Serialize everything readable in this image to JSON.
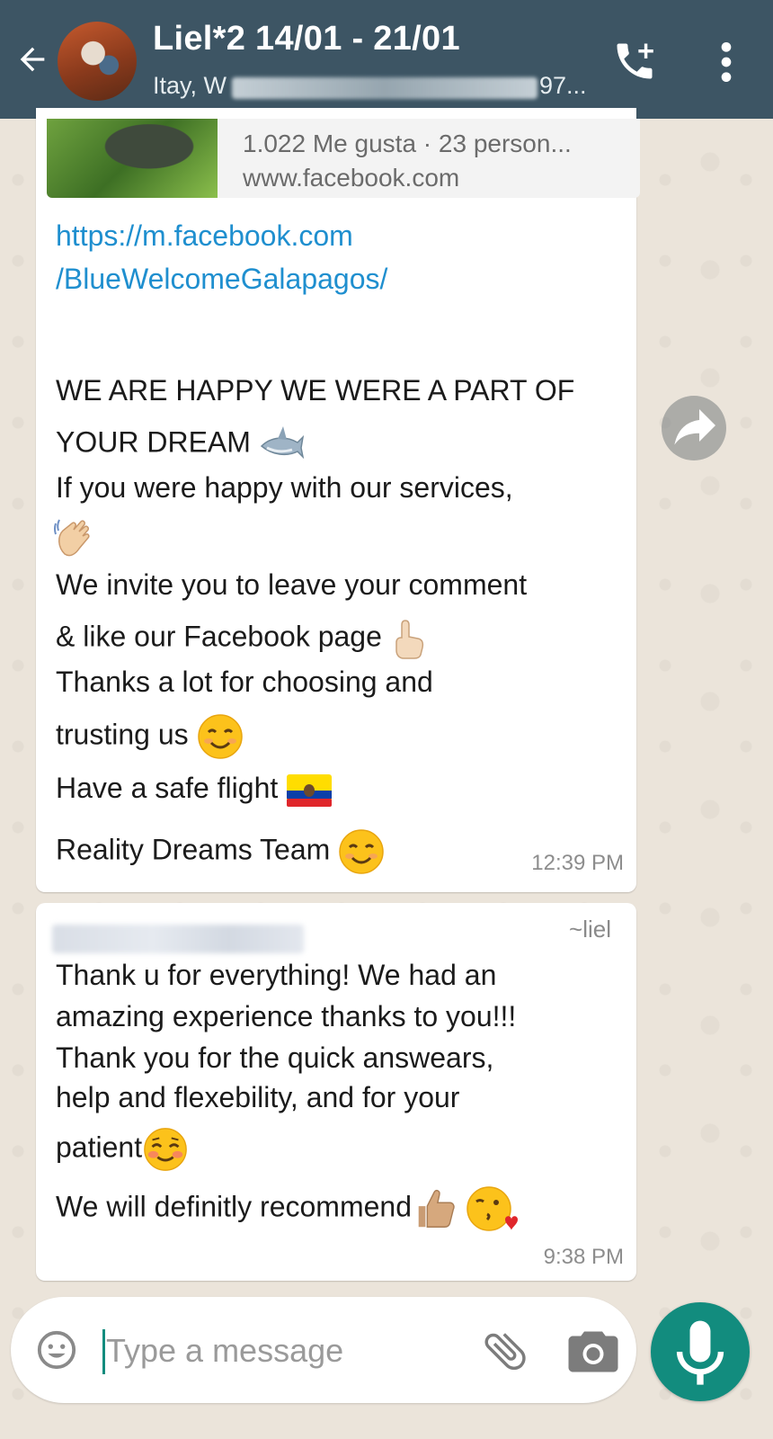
{
  "header": {
    "title": "Liel*2 14/01 - 21/01",
    "subtitle_start": "Itay, W",
    "subtitle_end": "97..."
  },
  "messages": [
    {
      "link_preview": {
        "likes": "1.022 Me gusta · 23 person...",
        "domain": "www.facebook.com"
      },
      "link_line1": "https://m.facebook.com",
      "link_line2": "/BlueWelcomeGalapagos/",
      "lines": [
        "WE ARE HAPPY WE WERE A PART OF",
        "YOUR DREAM",
        "If you were happy with our services,",
        "We invite you to leave your comment",
        "& like our Facebook page",
        "Thanks a lot for choosing and",
        "trusting us",
        "Have a safe flight",
        "Reality Dreams Team"
      ],
      "time": "12:39 PM"
    },
    {
      "sender": "~liel",
      "lines": [
        "Thank u for everything! We had an",
        "amazing experience thanks to you!!!",
        "Thank you for the quick answears,",
        "help and flexebility, and for your",
        "patient",
        "We will definitly recommend"
      ],
      "time": "9:38 PM"
    }
  ],
  "composer": {
    "placeholder": "Type a message"
  },
  "icons": {
    "back": "back-arrow-icon",
    "call": "add-call-icon",
    "menu": "more-vert-icon",
    "forward": "forward-icon",
    "emoji": "emoji-icon",
    "attach": "paperclip-icon",
    "camera": "camera-icon",
    "mic": "mic-icon"
  },
  "colors": {
    "header": "#3d5564",
    "accent": "#128c7e",
    "link": "#1f8fcf"
  }
}
